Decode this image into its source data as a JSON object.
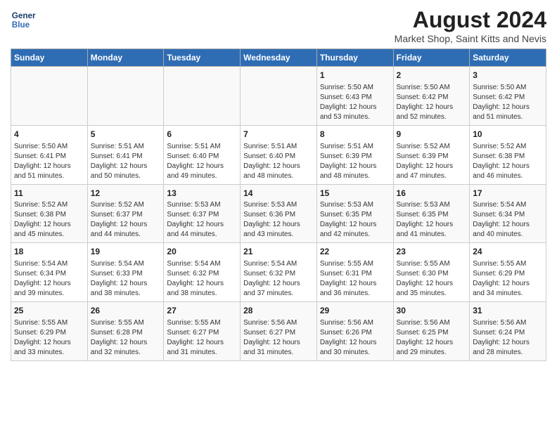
{
  "logo": {
    "line1": "General",
    "line2": "Blue"
  },
  "title": "August 2024",
  "subtitle": "Market Shop, Saint Kitts and Nevis",
  "days_of_week": [
    "Sunday",
    "Monday",
    "Tuesday",
    "Wednesday",
    "Thursday",
    "Friday",
    "Saturday"
  ],
  "weeks": [
    [
      {
        "day": "",
        "info": ""
      },
      {
        "day": "",
        "info": ""
      },
      {
        "day": "",
        "info": ""
      },
      {
        "day": "",
        "info": ""
      },
      {
        "day": "1",
        "info": "Sunrise: 5:50 AM\nSunset: 6:43 PM\nDaylight: 12 hours\nand 53 minutes."
      },
      {
        "day": "2",
        "info": "Sunrise: 5:50 AM\nSunset: 6:42 PM\nDaylight: 12 hours\nand 52 minutes."
      },
      {
        "day": "3",
        "info": "Sunrise: 5:50 AM\nSunset: 6:42 PM\nDaylight: 12 hours\nand 51 minutes."
      }
    ],
    [
      {
        "day": "4",
        "info": "Sunrise: 5:50 AM\nSunset: 6:41 PM\nDaylight: 12 hours\nand 51 minutes."
      },
      {
        "day": "5",
        "info": "Sunrise: 5:51 AM\nSunset: 6:41 PM\nDaylight: 12 hours\nand 50 minutes."
      },
      {
        "day": "6",
        "info": "Sunrise: 5:51 AM\nSunset: 6:40 PM\nDaylight: 12 hours\nand 49 minutes."
      },
      {
        "day": "7",
        "info": "Sunrise: 5:51 AM\nSunset: 6:40 PM\nDaylight: 12 hours\nand 48 minutes."
      },
      {
        "day": "8",
        "info": "Sunrise: 5:51 AM\nSunset: 6:39 PM\nDaylight: 12 hours\nand 48 minutes."
      },
      {
        "day": "9",
        "info": "Sunrise: 5:52 AM\nSunset: 6:39 PM\nDaylight: 12 hours\nand 47 minutes."
      },
      {
        "day": "10",
        "info": "Sunrise: 5:52 AM\nSunset: 6:38 PM\nDaylight: 12 hours\nand 46 minutes."
      }
    ],
    [
      {
        "day": "11",
        "info": "Sunrise: 5:52 AM\nSunset: 6:38 PM\nDaylight: 12 hours\nand 45 minutes."
      },
      {
        "day": "12",
        "info": "Sunrise: 5:52 AM\nSunset: 6:37 PM\nDaylight: 12 hours\nand 44 minutes."
      },
      {
        "day": "13",
        "info": "Sunrise: 5:53 AM\nSunset: 6:37 PM\nDaylight: 12 hours\nand 44 minutes."
      },
      {
        "day": "14",
        "info": "Sunrise: 5:53 AM\nSunset: 6:36 PM\nDaylight: 12 hours\nand 43 minutes."
      },
      {
        "day": "15",
        "info": "Sunrise: 5:53 AM\nSunset: 6:35 PM\nDaylight: 12 hours\nand 42 minutes."
      },
      {
        "day": "16",
        "info": "Sunrise: 5:53 AM\nSunset: 6:35 PM\nDaylight: 12 hours\nand 41 minutes."
      },
      {
        "day": "17",
        "info": "Sunrise: 5:54 AM\nSunset: 6:34 PM\nDaylight: 12 hours\nand 40 minutes."
      }
    ],
    [
      {
        "day": "18",
        "info": "Sunrise: 5:54 AM\nSunset: 6:34 PM\nDaylight: 12 hours\nand 39 minutes."
      },
      {
        "day": "19",
        "info": "Sunrise: 5:54 AM\nSunset: 6:33 PM\nDaylight: 12 hours\nand 38 minutes."
      },
      {
        "day": "20",
        "info": "Sunrise: 5:54 AM\nSunset: 6:32 PM\nDaylight: 12 hours\nand 38 minutes."
      },
      {
        "day": "21",
        "info": "Sunrise: 5:54 AM\nSunset: 6:32 PM\nDaylight: 12 hours\nand 37 minutes."
      },
      {
        "day": "22",
        "info": "Sunrise: 5:55 AM\nSunset: 6:31 PM\nDaylight: 12 hours\nand 36 minutes."
      },
      {
        "day": "23",
        "info": "Sunrise: 5:55 AM\nSunset: 6:30 PM\nDaylight: 12 hours\nand 35 minutes."
      },
      {
        "day": "24",
        "info": "Sunrise: 5:55 AM\nSunset: 6:29 PM\nDaylight: 12 hours\nand 34 minutes."
      }
    ],
    [
      {
        "day": "25",
        "info": "Sunrise: 5:55 AM\nSunset: 6:29 PM\nDaylight: 12 hours\nand 33 minutes."
      },
      {
        "day": "26",
        "info": "Sunrise: 5:55 AM\nSunset: 6:28 PM\nDaylight: 12 hours\nand 32 minutes."
      },
      {
        "day": "27",
        "info": "Sunrise: 5:55 AM\nSunset: 6:27 PM\nDaylight: 12 hours\nand 31 minutes."
      },
      {
        "day": "28",
        "info": "Sunrise: 5:56 AM\nSunset: 6:27 PM\nDaylight: 12 hours\nand 31 minutes."
      },
      {
        "day": "29",
        "info": "Sunrise: 5:56 AM\nSunset: 6:26 PM\nDaylight: 12 hours\nand 30 minutes."
      },
      {
        "day": "30",
        "info": "Sunrise: 5:56 AM\nSunset: 6:25 PM\nDaylight: 12 hours\nand 29 minutes."
      },
      {
        "day": "31",
        "info": "Sunrise: 5:56 AM\nSunset: 6:24 PM\nDaylight: 12 hours\nand 28 minutes."
      }
    ]
  ]
}
